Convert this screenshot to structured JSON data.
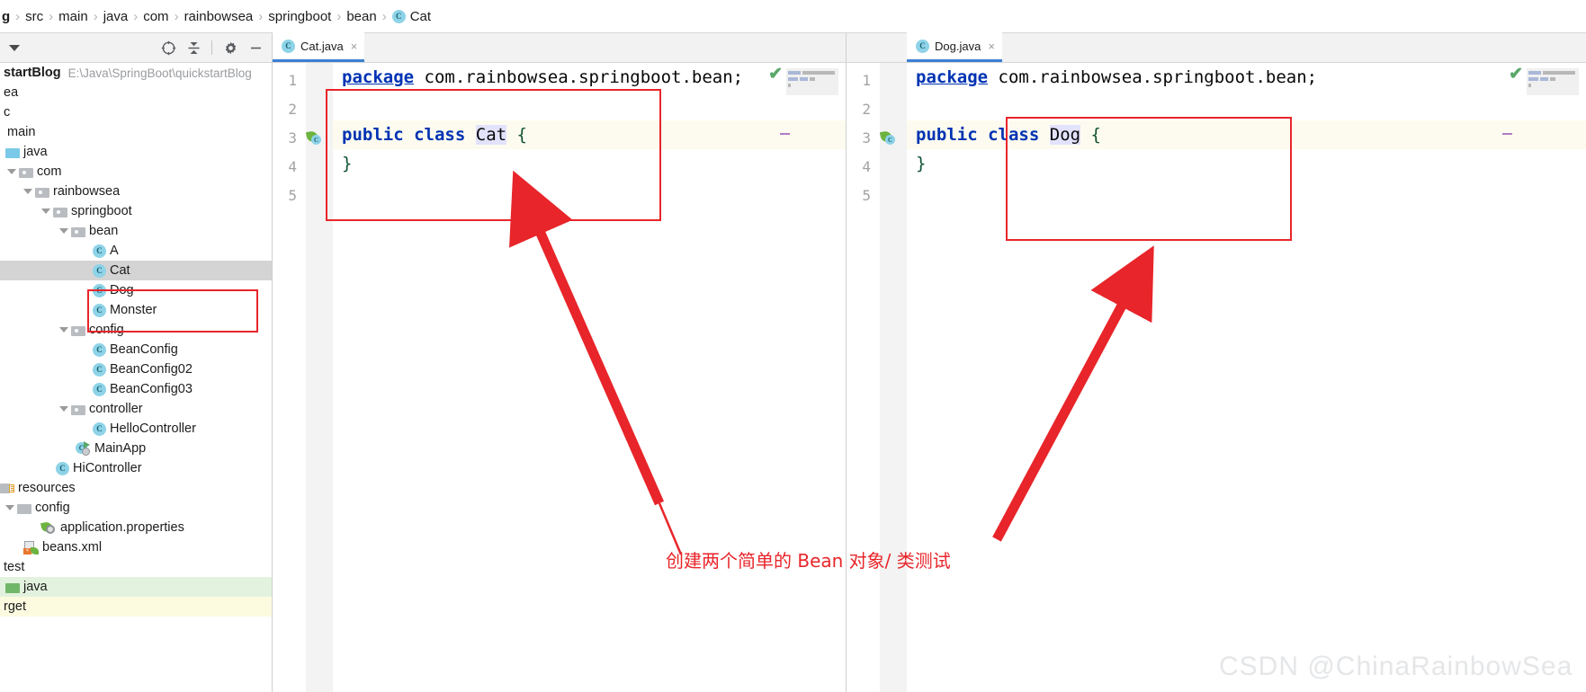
{
  "window": {
    "app": "IntelliJ IDEA",
    "watermark": "CSDN @ChinaRainbowSea"
  },
  "breadcrumb": {
    "items": [
      {
        "label": "g",
        "bold": true,
        "icon": null
      },
      {
        "label": "src",
        "bold": false,
        "icon": null
      },
      {
        "label": "main",
        "bold": false,
        "icon": null
      },
      {
        "label": "java",
        "bold": false,
        "icon": null
      },
      {
        "label": "com",
        "bold": false,
        "icon": null
      },
      {
        "label": "rainbowsea",
        "bold": false,
        "icon": null
      },
      {
        "label": "springboot",
        "bold": false,
        "icon": null
      },
      {
        "label": "bean",
        "bold": false,
        "icon": null
      },
      {
        "label": "Cat",
        "bold": false,
        "icon": "class-icon"
      }
    ],
    "separator": "›"
  },
  "project_toolbar": {
    "dropdown_label": "▼",
    "buttons": [
      {
        "name": "select-opened-file-icon",
        "tooltip": "Select Opened File"
      },
      {
        "name": "collapse-all-icon",
        "tooltip": "Collapse All"
      },
      {
        "name": "settings-gear-icon",
        "tooltip": "Options"
      },
      {
        "name": "hide-icon",
        "tooltip": "Hide"
      }
    ]
  },
  "project_tree": {
    "items": [
      {
        "label": "startBlog",
        "path": "E:\\Java\\SpringBoot\\quickstartBlog",
        "indent": 0,
        "icon": "none",
        "bold": true,
        "arrow": false,
        "state": "normal"
      },
      {
        "label": "ea",
        "path": "",
        "indent": 0,
        "icon": "none",
        "bold": false,
        "arrow": false,
        "state": "normal"
      },
      {
        "label": "c",
        "path": "",
        "indent": 0,
        "icon": "none",
        "bold": false,
        "arrow": false,
        "state": "normal"
      },
      {
        "label": "main",
        "path": "",
        "indent": 0,
        "icon": "none",
        "bold": false,
        "arrow": false,
        "state": "normal"
      },
      {
        "label": "java",
        "path": "",
        "indent": 1,
        "icon": "source-folder-icon",
        "bold": false,
        "arrow": false,
        "state": "normal"
      },
      {
        "label": "com",
        "path": "",
        "indent": 2,
        "icon": "package-folder-icon",
        "bold": false,
        "arrow": true,
        "state": "normal"
      },
      {
        "label": "rainbowsea",
        "path": "",
        "indent": 3,
        "icon": "package-folder-icon",
        "bold": false,
        "arrow": true,
        "state": "normal"
      },
      {
        "label": "springboot",
        "path": "",
        "indent": 4,
        "icon": "package-folder-icon",
        "bold": false,
        "arrow": true,
        "state": "normal"
      },
      {
        "label": "bean",
        "path": "",
        "indent": 5,
        "icon": "package-folder-icon",
        "bold": false,
        "arrow": true,
        "state": "normal"
      },
      {
        "label": "A",
        "path": "",
        "indent": 6,
        "icon": "class-icon",
        "bold": false,
        "arrow": false,
        "state": "normal"
      },
      {
        "label": "Cat",
        "path": "",
        "indent": 6,
        "icon": "class-icon",
        "bold": false,
        "arrow": false,
        "state": "selected"
      },
      {
        "label": "Dog",
        "path": "",
        "indent": 6,
        "icon": "class-icon",
        "bold": false,
        "arrow": false,
        "state": "normal"
      },
      {
        "label": "Monster",
        "path": "",
        "indent": 6,
        "icon": "class-icon",
        "bold": false,
        "arrow": false,
        "state": "normal"
      },
      {
        "label": "config",
        "path": "",
        "indent": 5,
        "icon": "package-folder-icon",
        "bold": false,
        "arrow": true,
        "state": "normal"
      },
      {
        "label": "BeanConfig",
        "path": "",
        "indent": 6,
        "icon": "class-icon",
        "bold": false,
        "arrow": false,
        "state": "normal"
      },
      {
        "label": "BeanConfig02",
        "path": "",
        "indent": 6,
        "icon": "class-icon",
        "bold": false,
        "arrow": false,
        "state": "normal"
      },
      {
        "label": "BeanConfig03",
        "path": "",
        "indent": 6,
        "icon": "class-icon",
        "bold": false,
        "arrow": false,
        "state": "normal"
      },
      {
        "label": "controller",
        "path": "",
        "indent": 5,
        "icon": "package-folder-icon",
        "bold": false,
        "arrow": true,
        "state": "normal"
      },
      {
        "label": "HelloController",
        "path": "",
        "indent": 6,
        "icon": "class-icon",
        "bold": false,
        "arrow": false,
        "state": "normal"
      },
      {
        "label": "MainApp",
        "path": "",
        "indent": 5,
        "icon": "runnable-class-icon",
        "bold": false,
        "arrow": false,
        "state": "normal"
      },
      {
        "label": "HiController",
        "path": "",
        "indent": 4,
        "icon": "class-icon",
        "bold": false,
        "arrow": false,
        "state": "normal"
      },
      {
        "label": "resources",
        "path": "",
        "indent": 0,
        "icon": "resources-folder-icon",
        "bold": false,
        "arrow": false,
        "state": "normal"
      },
      {
        "label": "config",
        "path": "",
        "indent": 1,
        "icon": "plain-folder-icon",
        "bold": false,
        "arrow": true,
        "state": "normal"
      },
      {
        "label": "application.properties",
        "path": "",
        "indent": 2,
        "icon": "spring-properties-icon",
        "bold": false,
        "arrow": false,
        "state": "normal"
      },
      {
        "label": "beans.xml",
        "path": "",
        "indent": 1,
        "icon": "spring-xml-icon",
        "bold": false,
        "arrow": false,
        "state": "normal"
      },
      {
        "label": "test",
        "path": "",
        "indent": 0,
        "icon": "none",
        "bold": false,
        "arrow": false,
        "state": "normal"
      },
      {
        "label": "java",
        "path": "",
        "indent": 0,
        "icon": "test-source-folder-icon",
        "bold": false,
        "arrow": false,
        "state": "green"
      },
      {
        "label": "rget",
        "path": "",
        "indent": 0,
        "icon": "none",
        "bold": false,
        "arrow": false,
        "state": "yellow"
      }
    ]
  },
  "editors": [
    {
      "id": "left",
      "tab": {
        "title": "Cat.java",
        "icon": "class-icon",
        "close": "×"
      },
      "line_numbers": [
        "1",
        "2",
        "3",
        "4",
        "5"
      ],
      "code": {
        "line1_kw": "package",
        "line1_rest": " com.rainbowsea.springboot.bean;",
        "line3_kw1": "public",
        "line3_kw2": "class",
        "line3_name": "Cat",
        "line3_brace": "{",
        "line4": "}"
      },
      "gutter_icons": [
        {
          "line": 2,
          "name": "intention-bulb-icon"
        },
        {
          "line": 3,
          "name": "spring-bean-gutter-icon"
        }
      ],
      "inspection": {
        "status": "ok",
        "check": "✔"
      }
    },
    {
      "id": "right",
      "tab": {
        "title": "Dog.java",
        "icon": "class-icon",
        "close": "×"
      },
      "line_numbers": [
        "1",
        "2",
        "3",
        "4",
        "5"
      ],
      "code": {
        "line1_kw": "package",
        "line1_rest": " com.rainbowsea.springboot.bean;",
        "line3_kw1": "public",
        "line3_kw2": "class",
        "line3_name": "Dog",
        "line3_brace": "{",
        "line4": "}"
      },
      "gutter_icons": [
        {
          "line": 3,
          "name": "spring-bean-gutter-icon"
        }
      ],
      "inspection": {
        "status": "ok",
        "check": "✔"
      }
    }
  ],
  "annotations": {
    "note_text": "创建两个简单的 Bean 对象/ 类测试",
    "accent_color": "#e8252a",
    "boxes": [
      {
        "name": "cat-dog-tree-highlight-box"
      },
      {
        "name": "cat-class-code-box"
      },
      {
        "name": "dog-class-code-box"
      }
    ],
    "arrows": [
      {
        "name": "arrow-to-cat-class"
      },
      {
        "name": "arrow-to-dog-class"
      }
    ]
  }
}
